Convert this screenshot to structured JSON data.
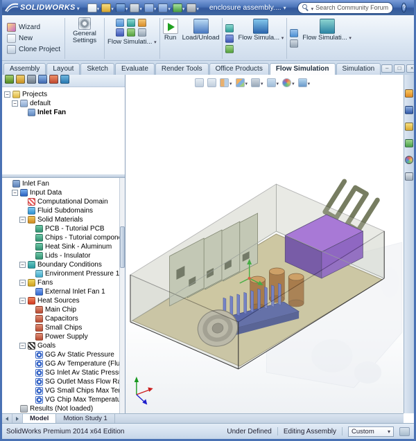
{
  "colors": {
    "titlebar_blue": "#4a74b8",
    "active_tab": "#fdfdfe",
    "enclosure_floor": "#c9c094",
    "power_supply": "#8a4fc8",
    "heat_sink": "#39489a",
    "capacitor": "#9a6228",
    "pcb_card": "#bcc2ac",
    "fan": "#b3ae9a"
  },
  "titlebar": {
    "app_name": "SOLIDWORKS",
    "document_name": "enclosure assembly....",
    "search_placeholder": "Search Community Forum",
    "icons": [
      {
        "name": "new-document-icon",
        "cls": "t-new"
      },
      {
        "name": "open-icon",
        "cls": "t-open"
      },
      {
        "name": "save-icon",
        "cls": "t-save"
      },
      {
        "name": "print-icon",
        "cls": "t-print"
      },
      {
        "name": "undo-icon",
        "cls": "t-undo"
      },
      {
        "name": "redo-icon",
        "cls": "t-redo"
      },
      {
        "name": "rebuild-icon",
        "cls": "t-rebuild"
      },
      {
        "name": "options-icon",
        "cls": "t-options"
      }
    ],
    "window_buttons": [
      {
        "name": "minimize-button",
        "cls": "wb-min"
      },
      {
        "name": "maximize-button",
        "cls": "wb-max"
      },
      {
        "name": "close-button",
        "cls": "wb-close"
      }
    ]
  },
  "ribbon": {
    "wizard": "Wizard",
    "new": "New",
    "clone_project": "Clone Project",
    "general_settings": "General Settings",
    "flow_simulation_1": "Flow Simulati...",
    "run": "Run",
    "load_unload": "Load/Unload",
    "flow_simulation_2": "Flow Simula...",
    "flow_simulation_3": "Flow Simulati..."
  },
  "command_tabs": [
    {
      "label": "Assembly",
      "cls": "",
      "name": "tab-assembly"
    },
    {
      "label": "Layout",
      "cls": "",
      "name": "tab-layout"
    },
    {
      "label": "Sketch",
      "cls": "",
      "name": "tab-sketch"
    },
    {
      "label": "Evaluate",
      "cls": "",
      "name": "tab-evaluate"
    },
    {
      "label": "Render Tools",
      "cls": "",
      "name": "tab-render-tools"
    },
    {
      "label": "Office Products",
      "cls": "",
      "name": "tab-office-products"
    },
    {
      "label": "Flow Simulation",
      "cls": "active",
      "name": "tab-flow-simulation"
    },
    {
      "label": "Simulation",
      "cls": "",
      "name": "tab-simulation"
    }
  ],
  "doc_window_buttons": [
    {
      "name": "viewport-minimize-button",
      "cls": "dwb-min"
    },
    {
      "name": "viewport-restore-button",
      "cls": "dwb-res"
    },
    {
      "name": "viewport-close-button",
      "cls": "dwb-close"
    }
  ],
  "panel_tabs": [
    {
      "name": "feature-manager-tab-icon",
      "cls": "pt1"
    },
    {
      "name": "property-manager-tab-icon",
      "cls": "pt2"
    },
    {
      "name": "configuration-manager-tab-icon",
      "cls": "pt3"
    },
    {
      "name": "dimxpert-manager-tab-icon",
      "cls": "pt4"
    },
    {
      "name": "display-manager-tab-icon",
      "cls": "pt5"
    },
    {
      "name": "flow-simulation-tab-icon",
      "cls": "pt6"
    }
  ],
  "project_tree": [
    {
      "label": "Projects",
      "lvl": 0,
      "icon": "i-pfolder",
      "exp": "minus",
      "cls": ""
    },
    {
      "label": "default",
      "lvl": 1,
      "icon": "i-proj",
      "exp": "minus",
      "cls": ""
    },
    {
      "label": "Inlet Fan",
      "lvl": 2,
      "icon": "i-proj2",
      "exp": "none",
      "cls": "bold"
    }
  ],
  "analysis_tree": [
    {
      "label": "Inlet Fan",
      "lvl": 0,
      "icon": "i-root",
      "exp": "none",
      "cls": ""
    },
    {
      "label": "Input Data",
      "lvl": 1,
      "icon": "i-input",
      "exp": "minus",
      "cls": ""
    },
    {
      "label": "Computational Domain",
      "lvl": 2,
      "icon": "i-domain",
      "exp": "none",
      "cls": ""
    },
    {
      "label": "Fluid Subdomains",
      "lvl": 2,
      "icon": "i-fluid",
      "exp": "none",
      "cls": ""
    },
    {
      "label": "Solid Materials",
      "lvl": 2,
      "icon": "i-solidmat",
      "exp": "minus",
      "cls": ""
    },
    {
      "label": "PCB - Tutorial PCB",
      "lvl": 3,
      "icon": "i-mat",
      "exp": "none",
      "cls": ""
    },
    {
      "label": "Chips - Tutorial component",
      "lvl": 3,
      "icon": "i-mat",
      "exp": "none",
      "cls": ""
    },
    {
      "label": "Heat Sink - Aluminum",
      "lvl": 3,
      "icon": "i-mat",
      "exp": "none",
      "cls": ""
    },
    {
      "label": "Lids - Insulator",
      "lvl": 3,
      "icon": "i-mat",
      "exp": "none",
      "cls": ""
    },
    {
      "label": "Boundary Conditions",
      "lvl": 2,
      "icon": "i-bc",
      "exp": "minus",
      "cls": ""
    },
    {
      "label": "Environment Pressure 1",
      "lvl": 3,
      "icon": "i-env",
      "exp": "none",
      "cls": ""
    },
    {
      "label": "Fans",
      "lvl": 2,
      "icon": "i-fans",
      "exp": "minus",
      "cls": ""
    },
    {
      "label": "External Inlet Fan 1",
      "lvl": 3,
      "icon": "i-fan",
      "exp": "none",
      "cls": ""
    },
    {
      "label": "Heat Sources",
      "lvl": 2,
      "icon": "i-heat",
      "exp": "minus",
      "cls": ""
    },
    {
      "label": "Main Chip",
      "lvl": 3,
      "icon": "i-chip",
      "exp": "none",
      "cls": ""
    },
    {
      "label": "Capacitors",
      "lvl": 3,
      "icon": "i-chip",
      "exp": "none",
      "cls": ""
    },
    {
      "label": "Small Chips",
      "lvl": 3,
      "icon": "i-chip",
      "exp": "none",
      "cls": ""
    },
    {
      "label": "Power Supply",
      "lvl": 3,
      "icon": "i-chip",
      "exp": "none",
      "cls": ""
    },
    {
      "label": "Goals",
      "lvl": 2,
      "icon": "i-goals",
      "exp": "minus",
      "cls": ""
    },
    {
      "label": "GG Av Static Pressure",
      "lvl": 3,
      "icon": "i-goal",
      "exp": "none",
      "cls": ""
    },
    {
      "label": "GG Av Temperature (Fluid)",
      "lvl": 3,
      "icon": "i-goal",
      "exp": "none",
      "cls": ""
    },
    {
      "label": "SG Inlet Av Static Pressure",
      "lvl": 3,
      "icon": "i-goal",
      "exp": "none",
      "cls": ""
    },
    {
      "label": "SG Outlet Mass Flow Rate",
      "lvl": 3,
      "icon": "i-goal",
      "exp": "none",
      "cls": ""
    },
    {
      "label": "VG Small Chips Max Tempera",
      "lvl": 3,
      "icon": "i-goal",
      "exp": "none",
      "cls": ""
    },
    {
      "label": "VG Chip Max Temperature",
      "lvl": 3,
      "icon": "i-goal",
      "exp": "none",
      "cls": ""
    },
    {
      "label": "Results (Not loaded)",
      "lvl": 1,
      "icon": "i-results",
      "exp": "none",
      "cls": ""
    }
  ],
  "hud_icons": [
    {
      "name": "zoom-fit-icon",
      "cls": "h-glass",
      "dd": ""
    },
    {
      "name": "zoom-area-icon",
      "cls": "h-glass",
      "dd": ""
    },
    {
      "name": "section-view-icon",
      "cls": "h-section",
      "dd": "show"
    },
    {
      "name": "view-orientation-icon",
      "cls": "h-cube",
      "dd": "show"
    },
    {
      "name": "display-style-icon",
      "cls": "h-display",
      "dd": "show"
    },
    {
      "name": "hide-show-items-icon",
      "cls": "h-eye",
      "dd": "show"
    },
    {
      "name": "edit-appearance-icon",
      "cls": "h-ball",
      "dd": "show"
    },
    {
      "name": "scene-icon",
      "cls": "h-scene",
      "dd": "show"
    }
  ],
  "task_pane_icons": [
    {
      "name": "solidworks-resources-icon",
      "cls": "tp1"
    },
    {
      "name": "design-library-icon",
      "cls": "tp2"
    },
    {
      "name": "file-explorer-icon",
      "cls": "tp3"
    },
    {
      "name": "view-palette-icon",
      "cls": "tp4"
    },
    {
      "name": "appearances-icon",
      "cls": "tp5"
    },
    {
      "name": "custom-properties-icon",
      "cls": "tp6"
    }
  ],
  "bottom_tabs": [
    {
      "label": "Model",
      "cls": "active",
      "name": "tab-model"
    },
    {
      "label": "Motion Study 1",
      "cls": "",
      "name": "tab-motion-study-1"
    }
  ],
  "statusbar": {
    "edition": "SolidWorks Premium 2014 x64 Edition",
    "state": "Under Defined",
    "mode": "Editing Assembly",
    "config": "Custom"
  }
}
